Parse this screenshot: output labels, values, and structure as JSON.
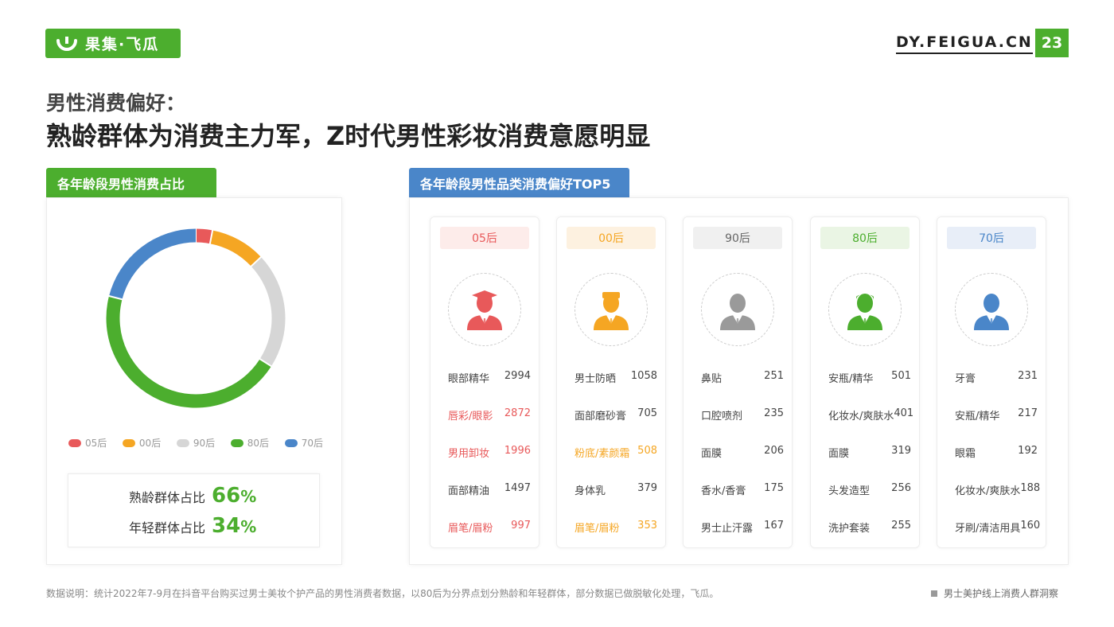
{
  "header": {
    "logo_text": "果集·飞瓜",
    "site": "DY.FEIGUA.CN",
    "page_number": "23"
  },
  "title": {
    "line1": "男性消费偏好：",
    "line2": "熟龄群体为消费主力军，Z时代男性彩妆消费意愿明显"
  },
  "left_panel": {
    "tab": "各年龄段男性消费占比",
    "mature_label": "熟龄群体占比",
    "mature_value": "66",
    "young_label": "年轻群体占比",
    "young_value": "34",
    "percent_sign": "%"
  },
  "right_panel": {
    "tab": "各年龄段男性品类消费偏好TOP5"
  },
  "colors": {
    "green": "#4cae2e",
    "blue": "#4a86c9",
    "red": "#e8595a",
    "orange": "#f5a623",
    "gray": "#d6d6d6"
  },
  "chart_data": [
    {
      "type": "pie",
      "style": "donut",
      "categories": [
        "05后",
        "00后",
        "90后",
        "80后",
        "70后"
      ],
      "values": [
        3,
        10,
        21,
        45,
        21
      ],
      "colors": [
        "#e8595a",
        "#f5a623",
        "#d6d6d6",
        "#4cae2e",
        "#4a86c9"
      ],
      "legend_position": "bottom"
    },
    {
      "type": "table",
      "columns": [
        {
          "header": "05后",
          "header_color": "#e8595a",
          "header_bg": "#fdecea",
          "icon": "graduate-avatar-icon",
          "icon_color": "#e8595a",
          "items": [
            {
              "name": "眼部精华",
              "value": "2994",
              "color": "#444444"
            },
            {
              "name": "唇彩/眼影",
              "value": "2872",
              "color": "#e8595a"
            },
            {
              "name": "男用卸妆",
              "value": "1996",
              "color": "#e8595a"
            },
            {
              "name": "面部精油",
              "value": "1497",
              "color": "#444444"
            },
            {
              "name": "眉笔/眉粉",
              "value": "997",
              "color": "#e8595a"
            }
          ]
        },
        {
          "header": "00后",
          "header_color": "#f5a623",
          "header_bg": "#fdf1e0",
          "icon": "student-avatar-icon",
          "icon_color": "#f5a623",
          "items": [
            {
              "name": "男士防晒",
              "value": "1058",
              "color": "#444444"
            },
            {
              "name": "面部磨砂膏",
              "value": "705",
              "color": "#444444"
            },
            {
              "name": "粉底/素颜霜",
              "value": "508",
              "color": "#f5a623"
            },
            {
              "name": "身体乳",
              "value": "379",
              "color": "#444444"
            },
            {
              "name": "眉笔/眉粉",
              "value": "353",
              "color": "#f5a623"
            }
          ]
        },
        {
          "header": "90后",
          "header_color": "#666666",
          "header_bg": "#f0f0f0",
          "icon": "businessman-avatar-icon",
          "icon_color": "#9a9a9a",
          "items": [
            {
              "name": "鼻贴",
              "value": "251",
              "color": "#444444"
            },
            {
              "name": "口腔喷剂",
              "value": "235",
              "color": "#444444"
            },
            {
              "name": "面膜",
              "value": "206",
              "color": "#444444"
            },
            {
              "name": "香水/香膏",
              "value": "175",
              "color": "#444444"
            },
            {
              "name": "男士止汗露",
              "value": "167",
              "color": "#444444"
            }
          ]
        },
        {
          "header": "80后",
          "header_color": "#4cae2e",
          "header_bg": "#eaf5e4",
          "icon": "man-avatar-icon",
          "icon_color": "#4cae2e",
          "items": [
            {
              "name": "安瓶/精华",
              "value": "501",
              "color": "#444444"
            },
            {
              "name": "化妆水/爽肤水",
              "value": "401",
              "color": "#444444"
            },
            {
              "name": "面膜",
              "value": "319",
              "color": "#444444"
            },
            {
              "name": "头发造型",
              "value": "256",
              "color": "#444444"
            },
            {
              "name": "洗护套装",
              "value": "255",
              "color": "#444444"
            }
          ]
        },
        {
          "header": "70后",
          "header_color": "#4a86c9",
          "header_bg": "#e8eef8",
          "icon": "suited-man-avatar-icon",
          "icon_color": "#4a86c9",
          "items": [
            {
              "name": "牙膏",
              "value": "231",
              "color": "#444444"
            },
            {
              "name": "安瓶/精华",
              "value": "217",
              "color": "#444444"
            },
            {
              "name": "眼霜",
              "value": "192",
              "color": "#444444"
            },
            {
              "name": "化妆水/爽肤水",
              "value": "188",
              "color": "#444444"
            },
            {
              "name": "牙刷/清洁用具",
              "value": "160",
              "color": "#444444"
            }
          ]
        }
      ]
    }
  ],
  "footer": {
    "note": "数据说明：统计2022年7-9月在抖音平台购买过男士美妆个护产品的男性消费者数据，以80后为分界点划分熟龄和年轻群体，部分数据已做脱敏化处理，飞瓜。",
    "report": "男士美护线上消费人群洞察"
  }
}
